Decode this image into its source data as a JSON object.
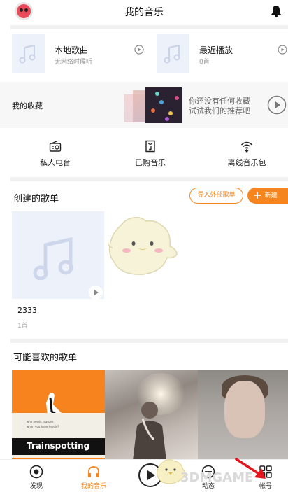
{
  "header": {
    "title": "我的音乐"
  },
  "cards": [
    {
      "title": "本地歌曲",
      "subtitle": "无网络时候听"
    },
    {
      "title": "最近播放",
      "subtitle": "0首"
    }
  ],
  "favorites": {
    "label": "我的收藏",
    "empty_line1": "你还没有任何收藏",
    "empty_line2": "试试我们的推荐吧"
  },
  "quick_actions": [
    {
      "label": "私人电台",
      "icon": "radio-icon"
    },
    {
      "label": "已购音乐",
      "icon": "purchased-music-icon"
    },
    {
      "label": "离线音乐包",
      "icon": "offline-wifi-icon"
    }
  ],
  "created": {
    "title": "创建的歌单",
    "import_label": "导入外部歌单",
    "new_label": "新建",
    "playlists": [
      {
        "name": "2333",
        "count": "1首"
      }
    ]
  },
  "recommend": {
    "title": "可能喜欢的歌单",
    "cover1_small1": "who needs reasons",
    "cover1_small2": "when you have heroin?",
    "cover1_title": "Trainspotting"
  },
  "tabs": [
    {
      "label": "发现",
      "icon": "discover-icon",
      "active": false
    },
    {
      "label": "我的音乐",
      "icon": "headphones-icon",
      "active": true
    },
    {
      "label": "动态",
      "icon": "feed-icon",
      "active": false
    },
    {
      "label": "帐号",
      "icon": "account-grid-icon",
      "active": false
    }
  ],
  "watermark": "3DMGAME",
  "colors": {
    "accent": "#f5861f",
    "background": "#ffffff"
  }
}
